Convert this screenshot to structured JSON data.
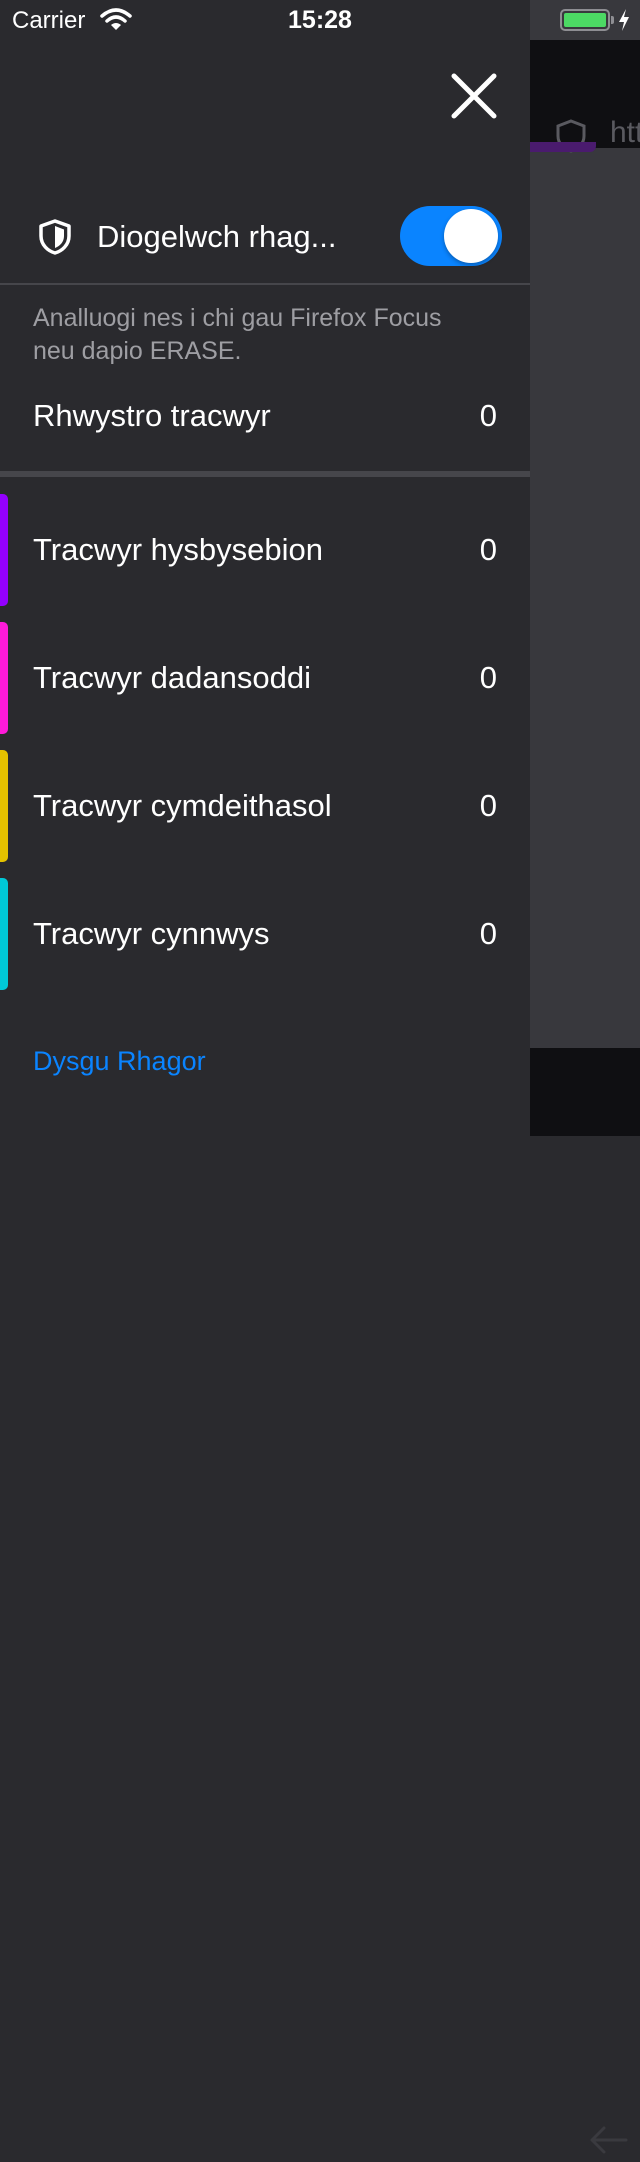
{
  "status_bar": {
    "carrier": "Carrier",
    "time": "15:28"
  },
  "background": {
    "url_fragment": "htt"
  },
  "drawer": {
    "protection": {
      "label": "Diogelwch rhag...",
      "enabled": true,
      "icon": "shield-icon"
    },
    "description": "Analluogi nes i chi gau Firefox Focus neu dapio ERASE.",
    "summary": {
      "label": "Rhwystro tracwyr",
      "count": "0"
    },
    "trackers": [
      {
        "label": "Tracwyr hysbysebion",
        "count": "0",
        "color": "#9400ff"
      },
      {
        "label": "Tracwyr dadansoddi",
        "count": "0",
        "color": "#ff1ad9"
      },
      {
        "label": "Tracwyr cymdeithasol",
        "count": "0",
        "color": "#e5c200"
      },
      {
        "label": "Tracwyr cynnwys",
        "count": "0",
        "color": "#00c8d7"
      }
    ],
    "learn_more": "Dysgu Rhagor"
  },
  "colors": {
    "accent": "#0a84ff",
    "drawer_bg": "#2a2a2e",
    "battery": "#4cd964"
  }
}
